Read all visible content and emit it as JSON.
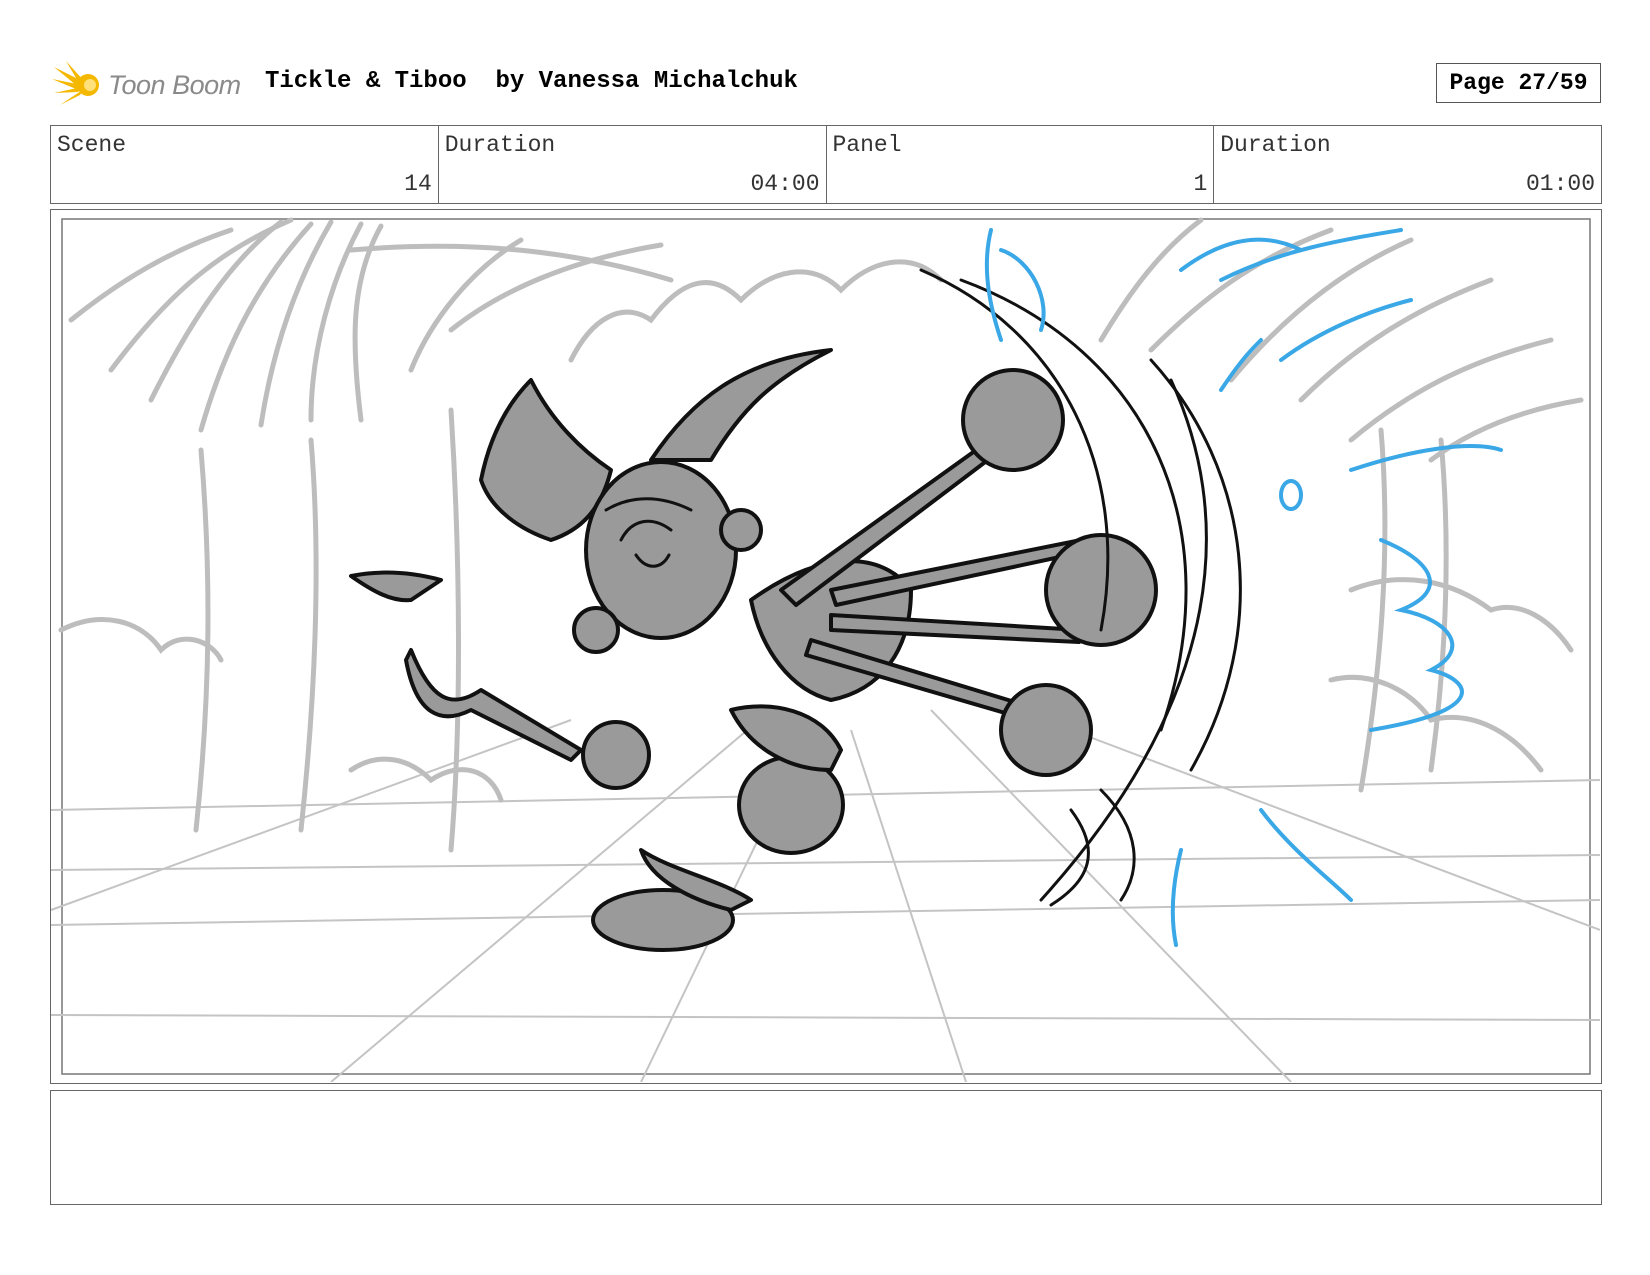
{
  "header": {
    "logo_text": "Toon Boom",
    "title": "Tickle & Tiboo  by Vanessa Michalchuk",
    "page": "Page 27/59"
  },
  "info": {
    "scene_label": "Scene",
    "scene_value": "14",
    "scene_duration_label": "Duration",
    "scene_duration_value": "04:00",
    "panel_label": "Panel",
    "panel_value": "1",
    "panel_duration_label": "Duration",
    "panel_duration_value": "01:00"
  },
  "notes": {
    "text": ""
  },
  "colors": {
    "logo_yellow": "#f5b800",
    "sketch_gray": "#bdbdbd",
    "character_fill": "#9a9a9a",
    "ink": "#111111",
    "effect_blue": "#3aa7e6"
  }
}
